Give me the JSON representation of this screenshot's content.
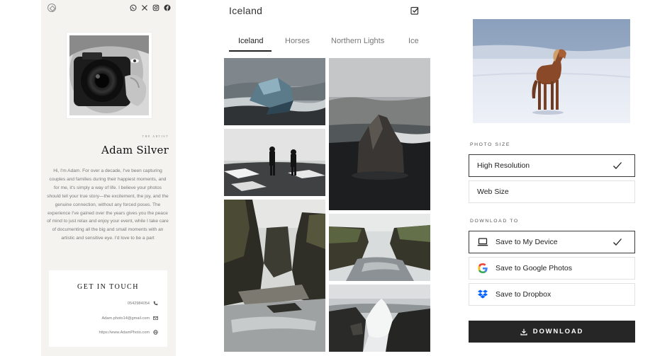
{
  "profile": {
    "eyebrow": "THE ARTIST",
    "name": "Adam Silver",
    "bio": "Hi, I'm Adam. For over a decade, I've been capturing couples and families during their happiest moments, and for me, it's simply a way of life. I believe your photos should tell your true story—the excitement, the joy, and the genuine connection, without any forced poses. The experience I've gained over the years gives you the peace of mind to just relax and enjoy your event, while I take care of documenting all the big and small moments with an artistic and sensitive eye. I'd love to be a part",
    "social_icons": [
      "whatsapp-icon",
      "x-icon",
      "instagram-icon",
      "facebook-icon"
    ]
  },
  "contact": {
    "title": "GET IN TOUCH",
    "phone": "0542984054",
    "email": "Adam.photo14@gmail.com",
    "website": "https://www.AdamPhoto.com"
  },
  "gallery": {
    "title": "Iceland",
    "tabs": [
      "Iceland",
      "Horses",
      "Northern Lights",
      "Ice"
    ],
    "active_tab": "Iceland"
  },
  "download_panel": {
    "photo_size_label": "PHOTO SIZE",
    "sizes": [
      {
        "label": "High Resolution",
        "selected": true
      },
      {
        "label": "Web Size",
        "selected": false
      }
    ],
    "download_to_label": "DOWNLOAD TO",
    "destinations": [
      {
        "label": "Save to My Device",
        "icon": "laptop-icon",
        "selected": true
      },
      {
        "label": "Save to Google Photos",
        "icon": "google-icon",
        "selected": false
      },
      {
        "label": "Save to Dropbox",
        "icon": "dropbox-icon",
        "selected": false
      }
    ],
    "download_label": "DOWNLOAD"
  },
  "colors": {
    "panel_bg": "#f4f3ef",
    "button_dark": "#262626",
    "selected_border": "#3a3a3a"
  }
}
